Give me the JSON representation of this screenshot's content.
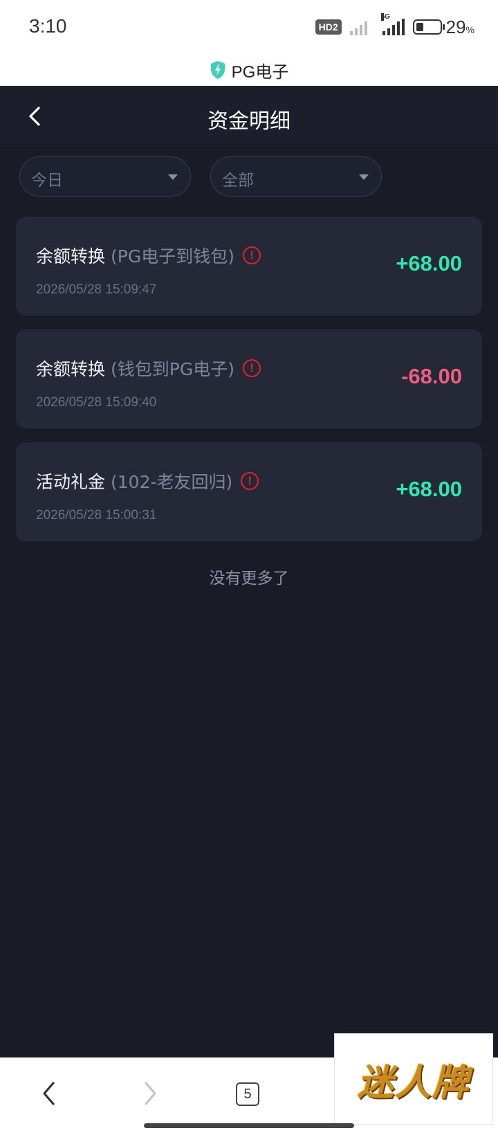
{
  "status_bar": {
    "time": "3:10",
    "hd_badge": "HD2",
    "network_tag": "5G",
    "battery_percent": "29",
    "battery_unit": "%",
    "battery_level": 0.29
  },
  "browser": {
    "site_title": "PG电子",
    "tab_count": "5"
  },
  "header": {
    "title": "资金明细"
  },
  "filters": {
    "date": "今日",
    "type": "全部"
  },
  "transactions": [
    {
      "type": "余额转换",
      "detail": "(PG电子到钱包)",
      "time": "2026/05/28 15:09:47",
      "amount": "+68.00"
    },
    {
      "type": "余额转换",
      "detail": "(钱包到PG电子)",
      "time": "2026/05/28 15:09:40",
      "amount": "-68.00"
    },
    {
      "type": "活动礼金",
      "detail": "(102-老友回归)",
      "time": "2026/05/28 15:00:31",
      "amount": "+68.00"
    }
  ],
  "info_glyph": "!",
  "list_end_text": "没有更多了",
  "watermark": "迷人牌",
  "colors": {
    "background": "#191b26",
    "card": "#252837",
    "positive": "#2ee8b0",
    "negative": "#ee5c7f",
    "warning": "#e0202f",
    "shield": "#3ecfb8"
  }
}
